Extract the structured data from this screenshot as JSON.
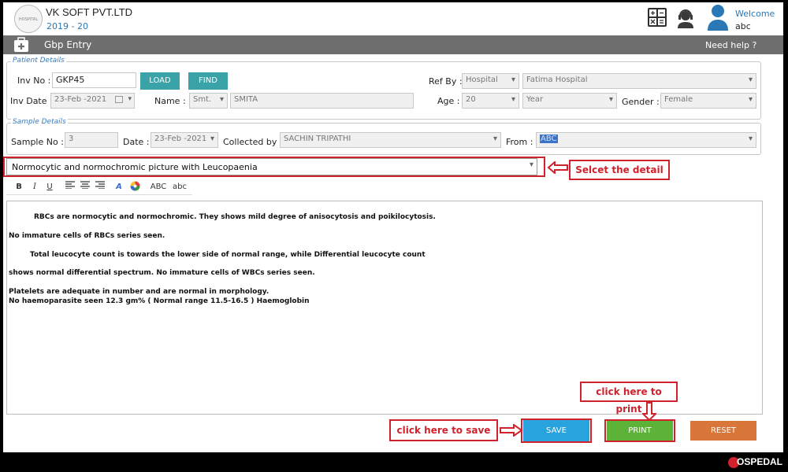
{
  "header": {
    "company": "VK SOFT PVT.LTD",
    "year": "2019 - 20",
    "logo_text": "HOSPITAL",
    "welcome": "Welcome",
    "user": "abc"
  },
  "titlebar": {
    "title": "Gbp Entry",
    "help": "Need help ?"
  },
  "patient": {
    "legend": "Patient Details",
    "inv_no_label": "Inv No :",
    "inv_no_value": "GKP45",
    "load_label": "LOAD",
    "find_label": "FIND",
    "ref_by_label": "Ref By :",
    "ref_type": "Hospital",
    "ref_name": "Fatima Hospital",
    "inv_date_label": "Inv Date :",
    "inv_date": "23-Feb -2021",
    "name_label": "Name :",
    "title": "Smt.",
    "name": "SMITA",
    "age_label": "Age :",
    "age": "20",
    "age_unit": "Year",
    "gender_label": "Gender :",
    "gender": "Female"
  },
  "sample": {
    "legend": "Sample Details",
    "no_label": "Sample No :",
    "no": "3",
    "date_label": "Date :",
    "date": "23-Feb -2021",
    "collected_label": "Collected by :",
    "collected": "SACHIN TRIPATHI",
    "from_label": "From :",
    "from": "ABC"
  },
  "template_select": "Normocytic and normochromic picture with Leucopaenia",
  "toolbar": {
    "bold": "B",
    "italic": "I",
    "underline": "U",
    "spell": "ABC",
    "spell_lower": "abc"
  },
  "editor": {
    "line1": "RBCs are normocytic and normochromic. They shows mild degree of anisocytosis and poikilocytosis.",
    "line2": "No immature cells of RBCs series seen.",
    "line3": "Total leucocyte count is towards the lower side of normal range, while Differential leucocyte count",
    "line4": "shows normal differential spectrum. No immature cells of WBCs series seen.",
    "line5": "Platelets are adequate in number and are normal in morphology.",
    "line6": "No haemoparasite seen    12.3 gm% ( Normal range 11.5-16.5 ) Haemoglobin"
  },
  "buttons": {
    "save": "SAVE",
    "print": "PRINT",
    "reset": "RESET"
  },
  "annotations": {
    "select": "Selcet the detail",
    "print": "click here to print",
    "save": "click here to save"
  },
  "brand": "OSPEDAL",
  "colors": {
    "accent_blue": "#2a78b6",
    "teal": "#3aa3a8",
    "save": "#29a3de",
    "print": "#5cb338",
    "reset": "#d9773b",
    "annotation_red": "#d0222c"
  }
}
